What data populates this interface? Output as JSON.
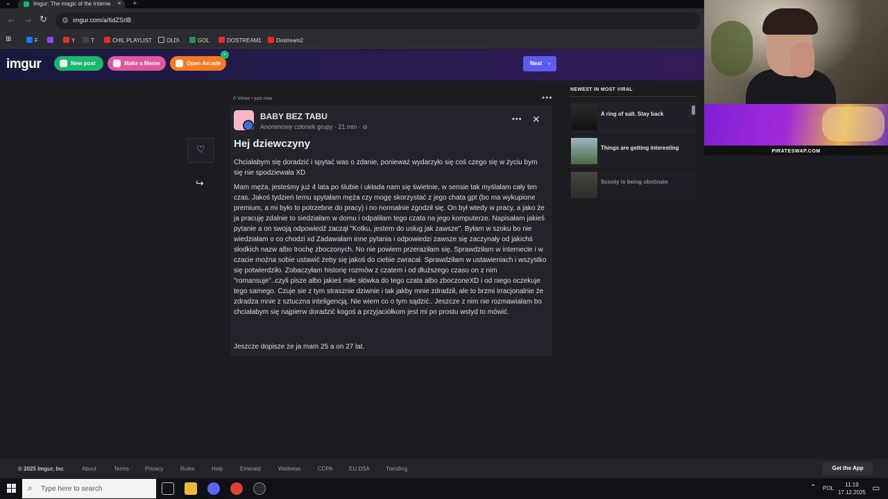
{
  "browser": {
    "tab_title": "Imgur: The magic of the Interne",
    "url": "imgur.com/a/6dZSrlB",
    "bookmarks": [
      "F",
      "Y",
      "T",
      "CHIL PLAYLIST",
      "OLD\\",
      "GOL",
      "DOSTREAM1",
      "Dostream2"
    ]
  },
  "header": {
    "logo": "imgur",
    "new_post": "New post",
    "make_meme": "Make a Meme",
    "open_arcade": "Open Arcade",
    "arcade_badge": "+",
    "next": "Next"
  },
  "post": {
    "meta": "0 Views • just now",
    "group_name": "BABY BEZ TABU",
    "member_line": "Anonimowy członek grupy · 21 min · ⊖",
    "title": "Hej dziewczyny",
    "paragraphs": [
      "Chciałabym się doradzić i spytać was o zdanie, ponieważ wydarzyło się coś czego się w życiu bym się nie spodziewała XD",
      "Mam męża, jesteśmy już 4 lata po ślubie i układa nam się świetnie, w sensie tak myślałam cały ten czas. Jakoś tydzień temu spytałam męża czy mogę skorzystać z jego chata gpt (bo ma wykupione premium, a mi było to potrzebne do pracy) i no normalnie zgodził się. On był wtedy w pracy, a jako że ja pracuję zdalnie to siedziałam w domu i odpaliłam tego czata na jego komputerze. Napisałam jakieś pytanie a on swoją odpowiedź zaczął \"Kotku, jestem do usług jak zawsze\". Byłam w szoku bo nie wiedziałam o co chodzi xd Zadawałam inne pytania i odpowiedzi zawsze się zaczynały od jakichś słodkich nazw albo trochę zboczonych. No nie powiem przeraziłam się. Sprawdziłam w internecie i w czacie można sobie ustawić żeby się jakoś do ciebie zwracał. Sprawdziłam w ustawieniach i wszystko się potwierdziło. Zobaczyłam historię rozmów z czatem i od dłuższego czasu on z nim \"romansuje\"..czyli pisze albo jakieś miłe słówka do tego czata albo zboczoneXD i od niego oczekuje tego samego. Czuje sie z tym strasznie dziwnie i tak jakby mnie zdradził, ale to brzmi irracjonalnie że zdradza mnie z sztuczna inteligencją. Nie wiem co o tym sądzić.. Jeszcze z nim nie rozmawiałam bo chciałabym się najpierw doradzić kogoś a przyjaciółkom jest mi po prostu wstyd to mówić.",
      "Jeszcze dopisze że ja mam 25 a on 27 lat."
    ]
  },
  "sidebar": {
    "heading": "NEWEST IN MOST VIRAL",
    "items": [
      {
        "label": "A ring of salt. Stay back"
      },
      {
        "label": "Things are getting interesting"
      },
      {
        "label": "Scooty is being obstinate"
      }
    ]
  },
  "ad": {
    "brand": "PIRATESWAP.COM"
  },
  "footer": {
    "copyright": "© 2025 Imgur, Inc",
    "links": [
      "About",
      "Terms",
      "Privacy",
      "Rules",
      "Help",
      "Emerald",
      "Wellness",
      "CCPA",
      "EU DSA",
      "Trending"
    ],
    "get_app": "Get the App"
  },
  "taskbar": {
    "search_placeholder": "Type here to search",
    "lang": "POL",
    "time": "11:19",
    "date": "17.12.2025"
  },
  "colors": {
    "accent_green": "#1bb76e",
    "accent_pink": "#e0569f",
    "accent_orange": "#f57a23",
    "next_blue": "#5c5cf0"
  }
}
